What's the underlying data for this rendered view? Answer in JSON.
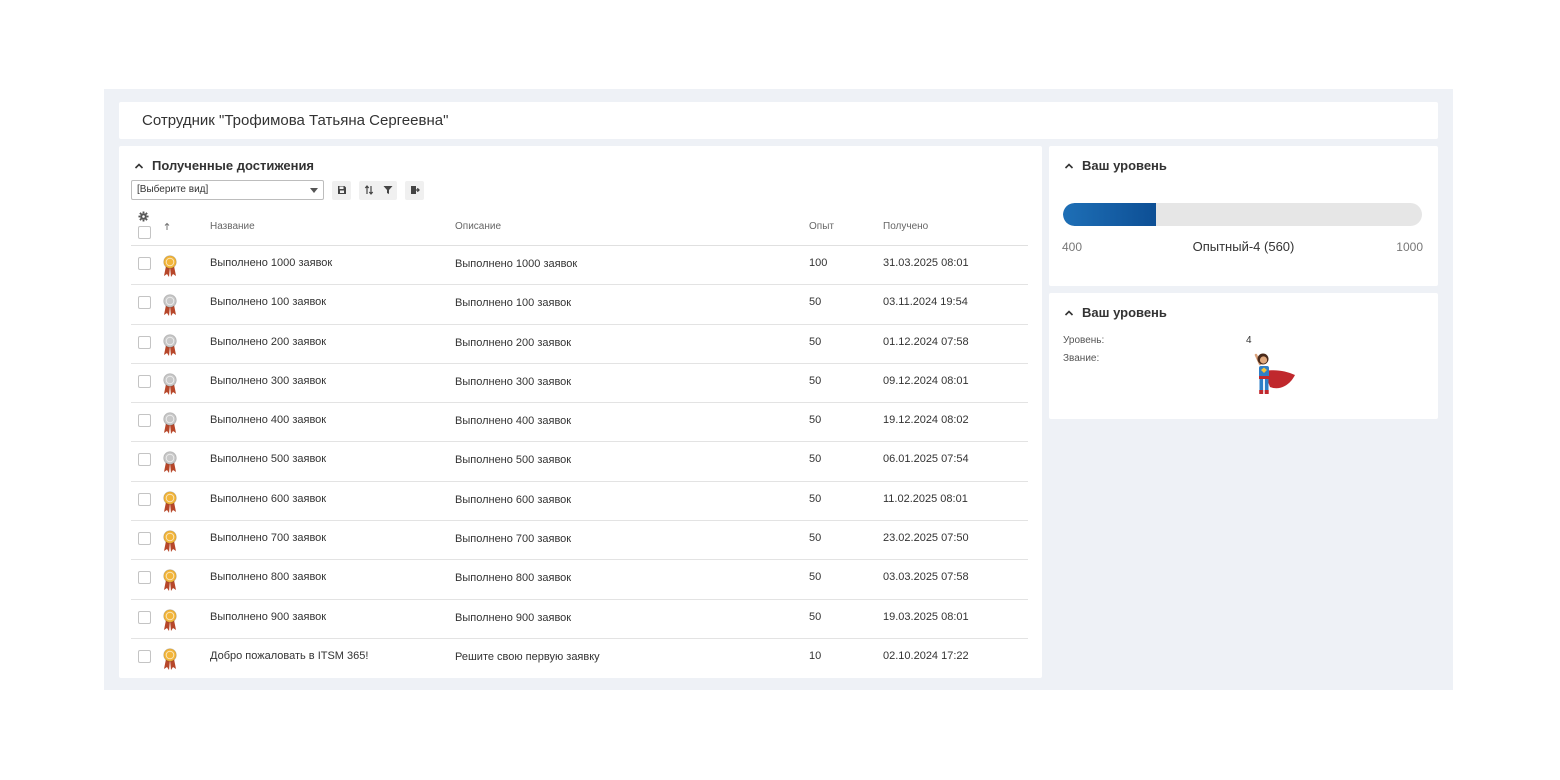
{
  "header": {
    "title": "Сотрудник \"Трофимова Татьяна Сергеевна\""
  },
  "achievements": {
    "section_title": "Полученные достижения",
    "view_select": "[Выберите вид]",
    "columns": {
      "name": "Название",
      "description": "Описание",
      "exp": "Опыт",
      "received": "Получено"
    },
    "rows": [
      {
        "medal": "gold",
        "name": "Выполнено 1000 заявок",
        "description": "Выполнено 1000 заявок",
        "exp": "100",
        "received": "31.03.2025 08:01"
      },
      {
        "medal": "silver",
        "name": "Выполнено 100 заявок",
        "description": "Выполнено 100 заявок",
        "exp": "50",
        "received": "03.11.2024 19:54"
      },
      {
        "medal": "silver",
        "name": "Выполнено 200 заявок",
        "description": "Выполнено 200 заявок",
        "exp": "50",
        "received": "01.12.2024 07:58"
      },
      {
        "medal": "silver",
        "name": "Выполнено 300 заявок",
        "description": "Выполнено 300 заявок",
        "exp": "50",
        "received": "09.12.2024 08:01"
      },
      {
        "medal": "silver",
        "name": "Выполнено 400 заявок",
        "description": "Выполнено 400 заявок",
        "exp": "50",
        "received": "19.12.2024 08:02"
      },
      {
        "medal": "silver",
        "name": "Выполнено 500 заявок",
        "description": "Выполнено 500 заявок",
        "exp": "50",
        "received": "06.01.2025 07:54"
      },
      {
        "medal": "gold",
        "name": "Выполнено 600 заявок",
        "description": "Выполнено 600 заявок",
        "exp": "50",
        "received": "11.02.2025 08:01"
      },
      {
        "medal": "gold",
        "name": "Выполнено 700 заявок",
        "description": "Выполнено 700 заявок",
        "exp": "50",
        "received": "23.02.2025 07:50"
      },
      {
        "medal": "gold",
        "name": "Выполнено 800 заявок",
        "description": "Выполнено 800 заявок",
        "exp": "50",
        "received": "03.03.2025 07:58"
      },
      {
        "medal": "gold",
        "name": "Выполнено 900 заявок",
        "description": "Выполнено 900 заявок",
        "exp": "50",
        "received": "19.03.2025 08:01"
      },
      {
        "medal": "gold",
        "name": "Добро пожаловать в ITSM 365!",
        "description": "Решите свою первую заявку",
        "exp": "10",
        "received": "02.10.2024 17:22"
      }
    ]
  },
  "level_progress": {
    "section_title": "Ваш уровень",
    "min": "400",
    "max": "1000",
    "current_label": "Опытный-4 (560)",
    "fill_fraction": 0.26
  },
  "level_info": {
    "section_title": "Ваш уровень",
    "level_label": "Уровень:",
    "level_value": "4",
    "rank_label": "Звание:",
    "rank_icon": "superhero-icon"
  },
  "colors": {
    "accent": "#0d4f95",
    "gold_medal": "#f2b53a",
    "silver_medal": "#c8c8c8",
    "ribbon": "#b7472a",
    "background": "#eef1f6"
  }
}
